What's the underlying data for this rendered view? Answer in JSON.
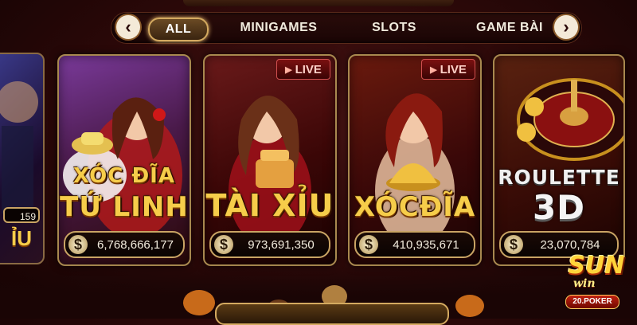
{
  "tabs": [
    {
      "label": "ALL",
      "active": true
    },
    {
      "label": "MINIGAMES",
      "active": false
    },
    {
      "label": "SLOTS",
      "active": false
    },
    {
      "label": "GAME BÀI",
      "active": false
    }
  ],
  "nav": {
    "prev_icon": "chevron-left-icon",
    "next_icon": "chevron-right-icon"
  },
  "partial_card": {
    "jackpot_fragment": "159",
    "title_fragment": "ỈU"
  },
  "cards": [
    {
      "title_line1": "XÓC ĐĨA",
      "title_line2": "TỨ LINH",
      "jackpot": "6,768,666,177",
      "live": false
    },
    {
      "title_line1": "TÀI XỈU",
      "jackpot": "973,691,350",
      "live": true,
      "live_label": "LIVE"
    },
    {
      "title_line1": "XÓCĐĨA",
      "jackpot": "410,935,671",
      "live": true,
      "live_label": "LIVE"
    },
    {
      "title_line1": "ROULETTE",
      "title_line2": "3D",
      "jackpot": "23,070,784",
      "live": false
    }
  ],
  "currency_symbol": "$",
  "logo": {
    "brand": "SUN",
    "sub": "win",
    "domain": "20.POKER"
  },
  "colors": {
    "accent_gold": "#f6cd4a",
    "bg": "#2a0808",
    "border": "#a8894f",
    "live_red": "#7a1010"
  }
}
